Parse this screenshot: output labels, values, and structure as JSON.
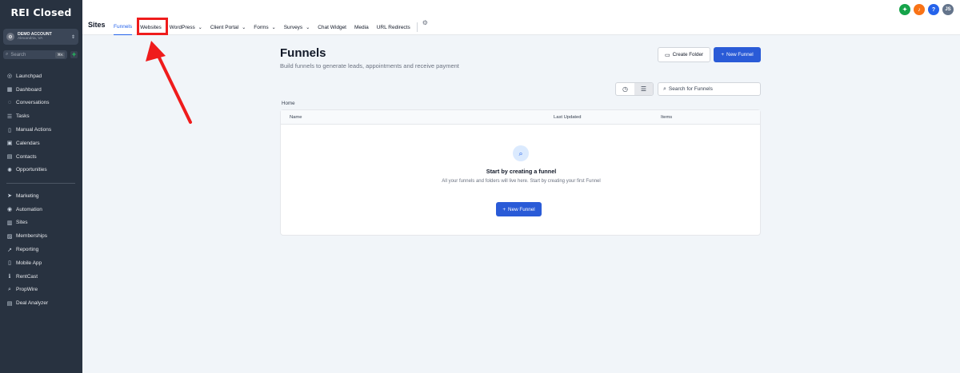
{
  "sidebar": {
    "logo": "REI Closed",
    "account": {
      "name": "DEMO ACCOUNT",
      "location": "Alexandria, VA"
    },
    "search": {
      "placeholder": "Search",
      "shortcut": "⌘K"
    },
    "items_top": [
      {
        "label": "Launchpad",
        "icon": "rocket-icon",
        "glyph": "◎"
      },
      {
        "label": "Dashboard",
        "icon": "grid-icon",
        "glyph": "▦"
      },
      {
        "label": "Conversations",
        "icon": "chat-icon",
        "glyph": "◌"
      },
      {
        "label": "Tasks",
        "icon": "list-icon",
        "glyph": "☰"
      },
      {
        "label": "Manual Actions",
        "icon": "phone-icon",
        "glyph": "▯"
      },
      {
        "label": "Calendars",
        "icon": "calendar-icon",
        "glyph": "▣"
      },
      {
        "label": "Contacts",
        "icon": "contact-icon",
        "glyph": "▤"
      },
      {
        "label": "Opportunities",
        "icon": "opportunities-icon",
        "glyph": "✺"
      }
    ],
    "items_bottom": [
      {
        "label": "Marketing",
        "icon": "send-icon",
        "glyph": "➤"
      },
      {
        "label": "Automation",
        "icon": "automation-icon",
        "glyph": "◉"
      },
      {
        "label": "Sites",
        "icon": "sites-icon",
        "glyph": "▥"
      },
      {
        "label": "Memberships",
        "icon": "memberships-icon",
        "glyph": "▨"
      },
      {
        "label": "Reporting",
        "icon": "reporting-icon",
        "glyph": "↗"
      },
      {
        "label": "Mobile App",
        "icon": "mobile-icon",
        "glyph": "▯"
      },
      {
        "label": "RentCast",
        "icon": "info-icon",
        "glyph": "ℹ"
      },
      {
        "label": "PropWire",
        "icon": "search-icon",
        "glyph": "⌕"
      },
      {
        "label": "Deal Analyzer",
        "icon": "calculator-icon",
        "glyph": "▤"
      }
    ]
  },
  "topbar": {
    "title": "Sites",
    "tabs": [
      {
        "label": "Funnels",
        "active": true,
        "caret": false
      },
      {
        "label": "Websites",
        "active": false,
        "caret": false
      },
      {
        "label": "WordPress",
        "active": false,
        "caret": true
      },
      {
        "label": "Client Portal",
        "active": false,
        "caret": true
      },
      {
        "label": "Forms",
        "active": false,
        "caret": true
      },
      {
        "label": "Surveys",
        "active": false,
        "caret": true
      },
      {
        "label": "Chat Widget",
        "active": false,
        "caret": false
      },
      {
        "label": "Media",
        "active": false,
        "caret": false
      },
      {
        "label": "URL Redirects",
        "active": false,
        "caret": false
      }
    ],
    "avatar_initials": "JS",
    "icon_colors": {
      "megaphone": "#16a34a",
      "bell": "#f97316",
      "help": "#2563eb",
      "avatar": "#64748b"
    }
  },
  "main": {
    "title": "Funnels",
    "subtitle": "Build funnels to generate leads, appointments and receive payment",
    "create_folder_label": "Create Folder",
    "new_funnel_label": "New Funnel",
    "search_placeholder": "Search for Funnels",
    "breadcrumb": "Home",
    "columns": {
      "name": "Name",
      "last_updated": "Last Updated",
      "items": "Items"
    },
    "empty": {
      "title": "Start by creating a funnel",
      "text": "All your funnels and folders will live here. Start by creating your first Funnel",
      "button": "New Funnel"
    }
  },
  "colors": {
    "accent": "#2a5bd7",
    "sidebar": "#283240",
    "annotation": "#ef1c1c"
  }
}
